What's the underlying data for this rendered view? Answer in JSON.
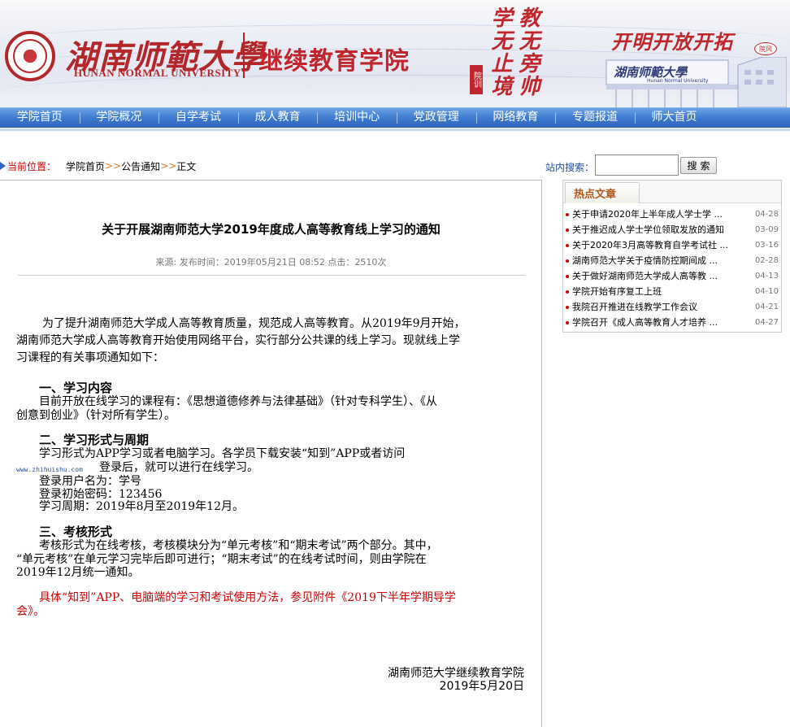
{
  "header": {
    "university_cn": "湖南师範大學",
    "university_en": "HUNAN NORMAL UNIVERSITY",
    "college": "继续教育学院",
    "motto_col1": "学无止境",
    "motto_col2": "教无旁帅",
    "motto_stamp": "院训",
    "slogan": "开明开放开拓",
    "slogan_badge": "院风",
    "building_sign": "湖南师範大學",
    "building_sign_en": "Hunan Normal University"
  },
  "nav": {
    "items": [
      "学院首页",
      "学院概况",
      "自学考试",
      "成人教育",
      "培训中心",
      "党政管理",
      "网络教育",
      "专题报道",
      "师大首页"
    ]
  },
  "breadcrumb": {
    "label": "当前位置：",
    "items": [
      "学院首页",
      "公告通知",
      "正文"
    ],
    "separator": ">>"
  },
  "search": {
    "label": "站内搜索：",
    "value": "",
    "button": "搜索"
  },
  "article": {
    "title": "关于开展湖南师范大学2019年度成人高等教育线上学习的通知",
    "meta": "来源:  发布时间：2019年05月21日 08:52 点击：2510次",
    "intro_lines": [
      "为了提升湖南师范大学成人高等教育质量，规范成人高等教育。从2019年9月开始，",
      "湖南师范大学成人高等教育开始使用网络平台，实行部分公共课的线上学习。现就线上学",
      "习课程的有关事项通知如下："
    ],
    "s1_heading": "一、学习内容",
    "s1_lines": [
      "目前开放在线学习的课程有：《思想道德修养与法律基础》（针对专科学生）、《从",
      "创意到创业》（针对所有学生）。"
    ],
    "s2_heading": "二、学习形式与周期",
    "s2_lines": [
      "学习形式为APP学习或者电脑学习。各学员下载安装“知到”APP或者访问",
      "登录后，就可以进行在线学习。",
      "登录用户名为：学号",
      "登录初始密码：123456",
      "学习周期：2019年8月至2019年12月。"
    ],
    "watermark": "www.zhihuishu.com",
    "s3_heading": "三、考核形式",
    "s3_lines": [
      "考核形式为在线考核，考核模块分为“单元考核”和“期末考试”两个部分。其中，",
      "“单元考核”在单元学习完毕后即可进行；“期末考试”的在线考试时间，则由学院在",
      "2019年12月统一通知。"
    ],
    "note_lines": [
      "具体“知到”APP、电脑端的学习和考试使用方法，参见附件《2019下半年学期导学",
      "会》。"
    ],
    "signature": "湖南师范大学继续教育学院",
    "date": "2019年5月20日"
  },
  "hot": {
    "title": "热点文章",
    "items": [
      {
        "title": "关于申请2020年上半年成人学士学 ...",
        "date": "04-28"
      },
      {
        "title": "关于推迟成人学士学位领取发放的通知",
        "date": "03-09"
      },
      {
        "title": "关于2020年3月高等教育自学考试社 ...",
        "date": "03-16"
      },
      {
        "title": "湖南师范大学关于疫情防控期间成 ...",
        "date": "02-28"
      },
      {
        "title": "关于做好湖南师范大学成人高等教 ...",
        "date": "04-13"
      },
      {
        "title": "学院开始有序复工上班",
        "date": "04-10"
      },
      {
        "title": "我院召开推进在线教学工作会议",
        "date": "04-21"
      },
      {
        "title": "学院召开《成人高等教育人才培养 ...",
        "date": "04-27"
      }
    ]
  },
  "colors": {
    "brand_red": "#c0262d",
    "nav_blue": "#3d79cf",
    "note_red": "#cc0000"
  }
}
